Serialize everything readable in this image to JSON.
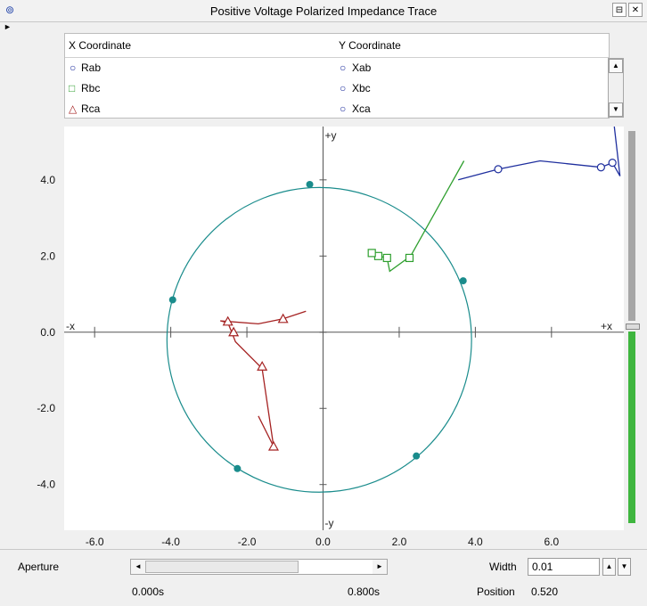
{
  "window": {
    "title": "Positive Voltage Polarized Impedance Trace"
  },
  "legend": {
    "x_header": "X Coordinate",
    "y_header": "Y Coordinate",
    "rows": [
      {
        "x_label": "Rab",
        "x_symbol": "circle",
        "y_label": "Xab",
        "y_symbol": "circle",
        "color": "#1f2f9e"
      },
      {
        "x_label": "Rbc",
        "x_symbol": "square",
        "y_label": "Xbc",
        "y_symbol": "circle",
        "color": "#2f9f2f"
      },
      {
        "x_label": "Rca",
        "x_symbol": "triangle",
        "y_label": "Xca",
        "y_symbol": "circle",
        "color": "#a52222"
      }
    ]
  },
  "chart_data": {
    "type": "scatter",
    "xlim": [
      -6.8,
      7.9
    ],
    "ylim": [
      -5.2,
      5.4
    ],
    "xticks": [
      -6,
      -4,
      -2,
      0,
      2,
      4,
      6
    ],
    "yticks": [
      4,
      2,
      0,
      -2,
      -4
    ],
    "x_tick_labels": [
      "-6.0",
      "-4.0",
      "-2.0",
      "0.0",
      "2.0",
      "4.0",
      "6.0"
    ],
    "y_tick_labels": [
      "4.0",
      "2.0",
      "0.0",
      "-2.0",
      "-4.0"
    ],
    "axis_labels": {
      "pos_x": "+x",
      "neg_x": "-x",
      "pos_y": "+y",
      "neg_y": "-y"
    },
    "circle": {
      "color": "#1a8c8c",
      "center": [
        -0.1,
        -0.2
      ],
      "radius": 4.0,
      "markers": [
        [
          -0.35,
          3.88
        ],
        [
          -3.95,
          0.85
        ],
        [
          3.68,
          1.35
        ],
        [
          -2.25,
          -3.58
        ],
        [
          2.45,
          -3.25
        ]
      ]
    },
    "series": [
      {
        "name": "Rab/Xab",
        "color": "#1f2f9e",
        "marker": "circle",
        "line": [
          [
            3.55,
            4.0
          ],
          [
            4.6,
            4.28
          ],
          [
            5.7,
            4.5
          ],
          [
            7.3,
            4.33
          ],
          [
            7.6,
            4.45
          ],
          [
            7.8,
            4.1
          ],
          [
            7.65,
            5.4
          ]
        ],
        "markers": [
          [
            4.6,
            4.28
          ],
          [
            7.3,
            4.33
          ],
          [
            7.6,
            4.45
          ]
        ]
      },
      {
        "name": "Rbc/Xbc",
        "color": "#2f9f2f",
        "marker": "square",
        "line": [
          [
            3.7,
            4.5
          ],
          [
            2.3,
            2.0
          ],
          [
            1.75,
            1.6
          ],
          [
            1.68,
            1.95
          ],
          [
            1.45,
            2.0
          ],
          [
            1.28,
            2.1
          ],
          [
            1.38,
            2.05
          ]
        ],
        "markers": [
          [
            2.27,
            1.95
          ],
          [
            1.68,
            1.95
          ],
          [
            1.45,
            2.0
          ],
          [
            1.28,
            2.08
          ]
        ]
      },
      {
        "name": "Rca/Xca",
        "color": "#a52222",
        "marker": "triangle",
        "line": [
          [
            -0.45,
            0.55
          ],
          [
            -1.05,
            0.35
          ],
          [
            -1.7,
            0.22
          ],
          [
            -2.7,
            0.3
          ],
          [
            -2.5,
            0.25
          ],
          [
            -2.4,
            0.0
          ],
          [
            -2.3,
            -0.25
          ],
          [
            -1.6,
            -0.95
          ],
          [
            -1.3,
            -3.0
          ],
          [
            -1.7,
            -2.2
          ]
        ],
        "markers": [
          [
            -1.05,
            0.35
          ],
          [
            -2.5,
            0.28
          ],
          [
            -2.35,
            0.0
          ],
          [
            -1.6,
            -0.9
          ],
          [
            -1.3,
            -3.0
          ]
        ]
      }
    ]
  },
  "controls": {
    "aperture_label": "Aperture",
    "time_start": "0.000s",
    "time_end": "0.800s",
    "width_label": "Width",
    "width_value": "0.01",
    "position_label": "Position",
    "position_value": "0.520"
  }
}
